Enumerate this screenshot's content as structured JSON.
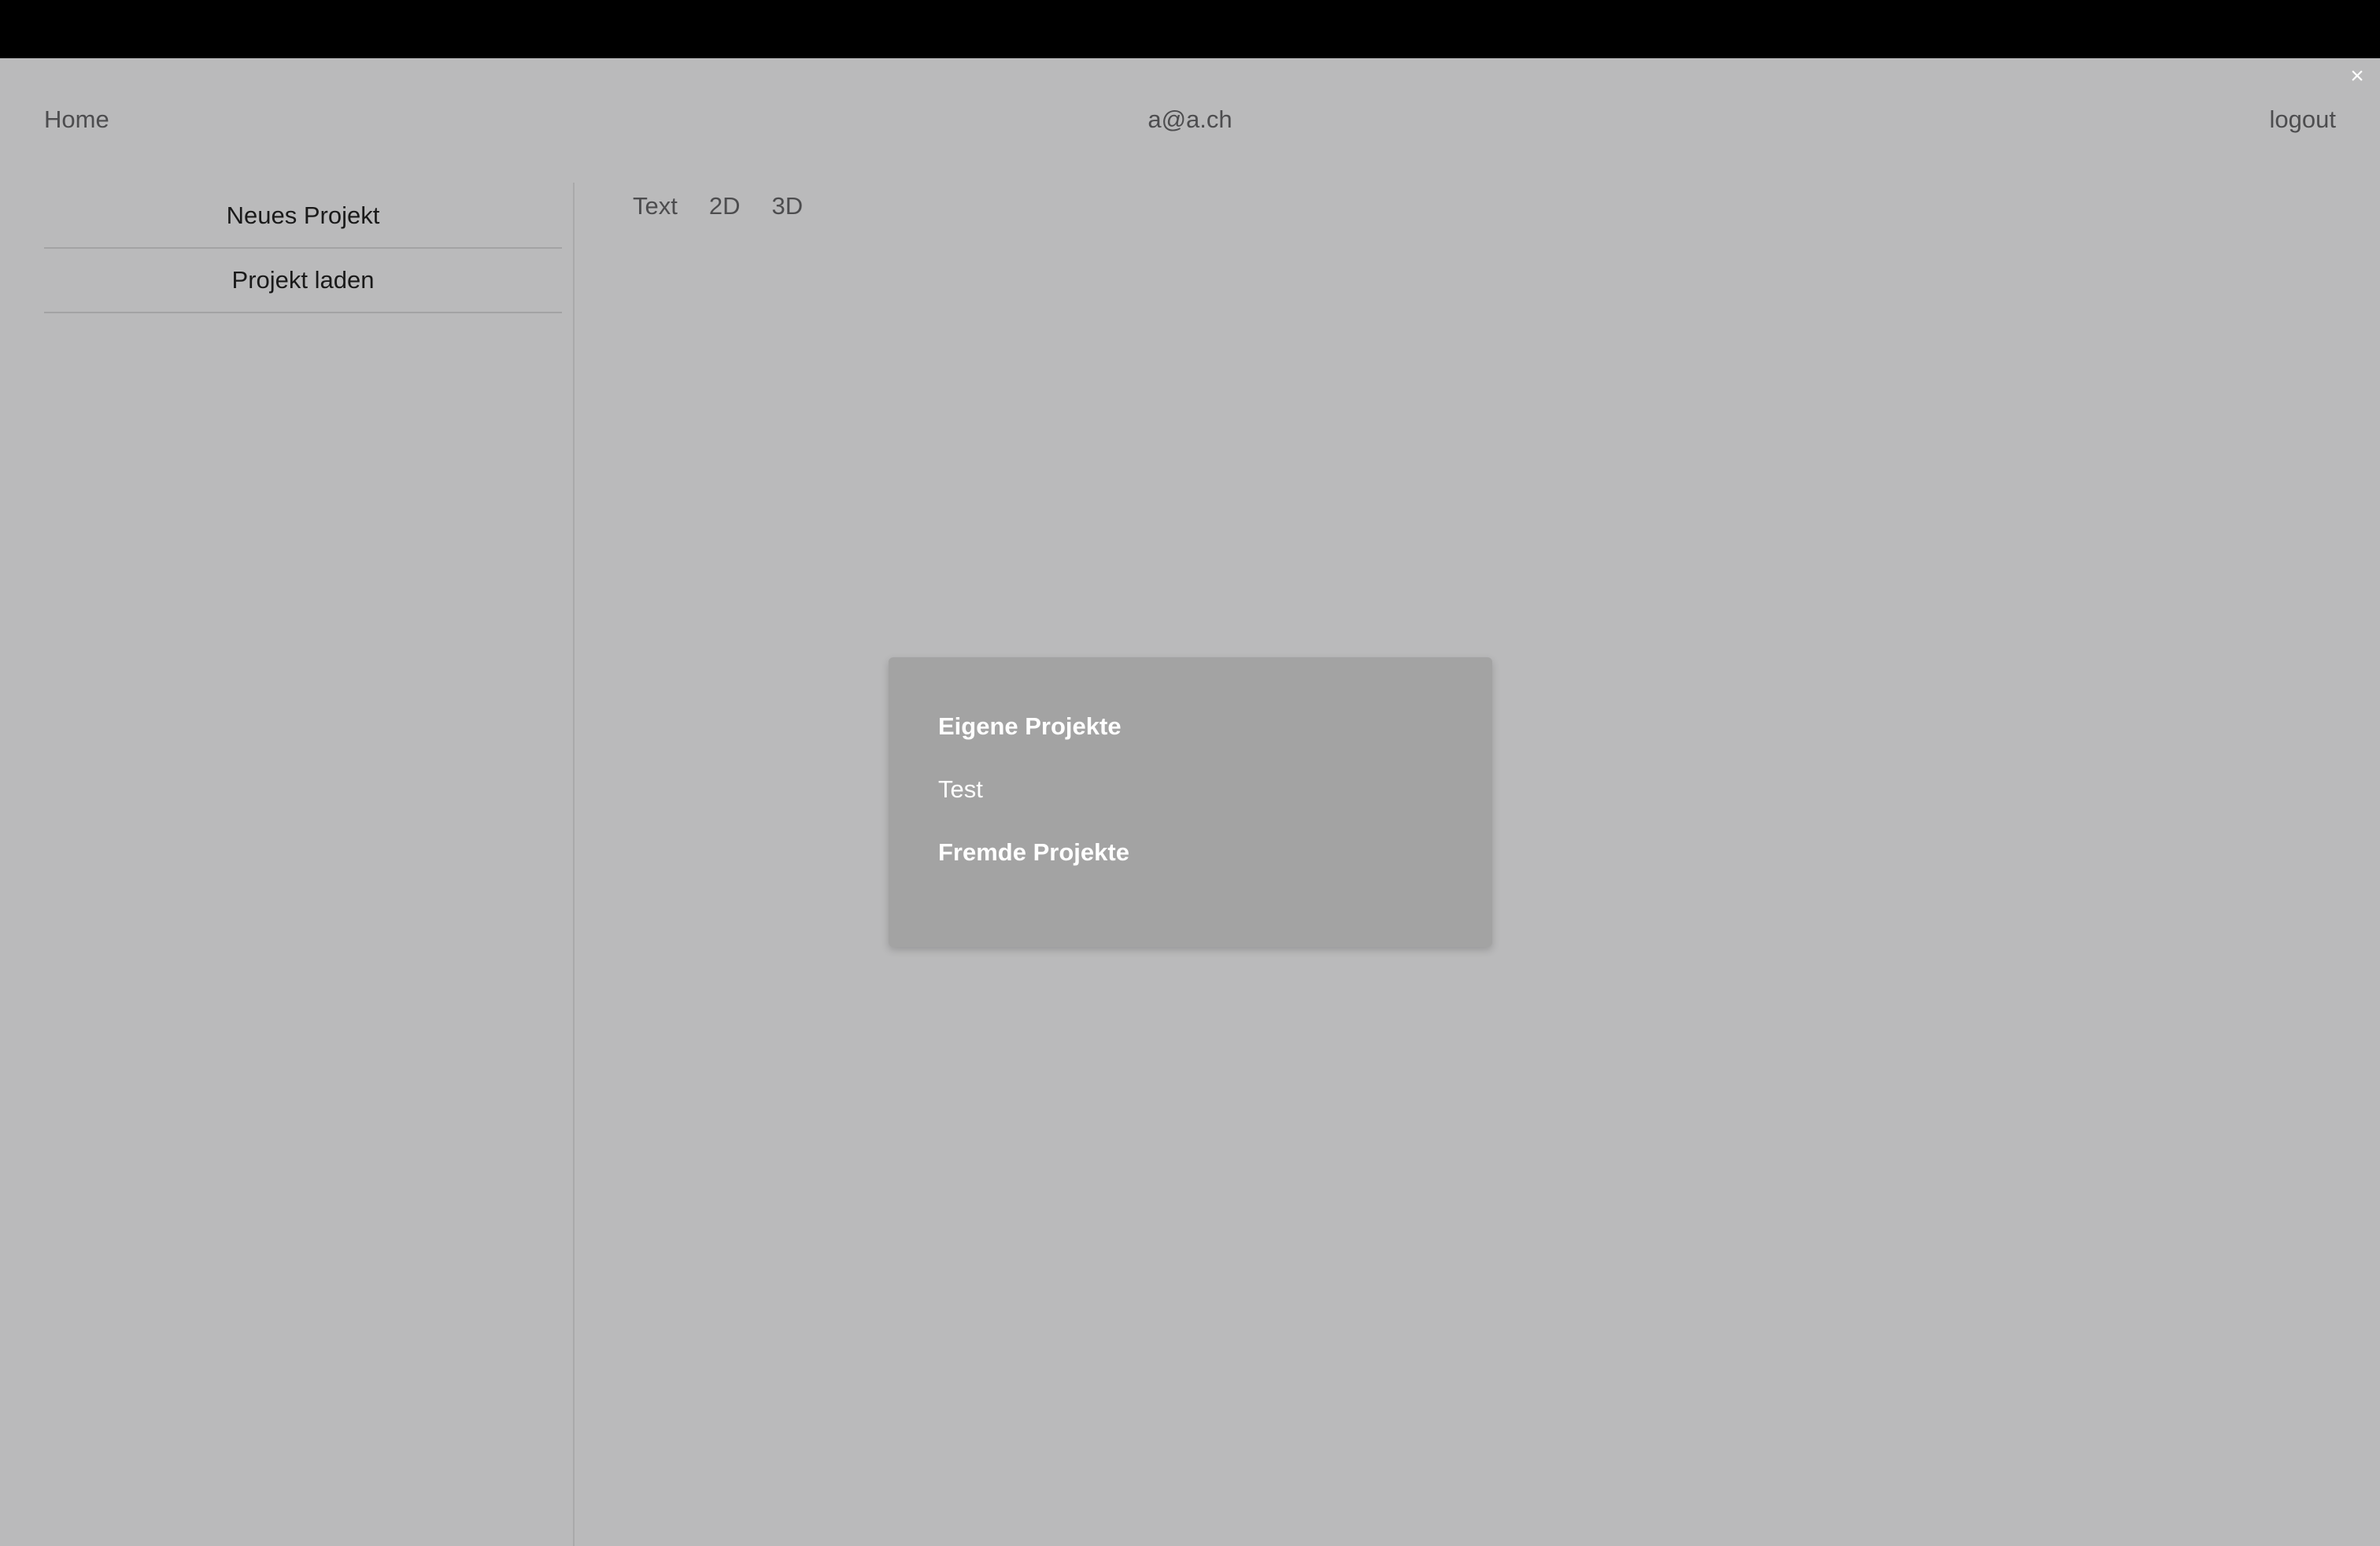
{
  "window": {
    "close_label": "×"
  },
  "header": {
    "home": "Home",
    "user_email": "a@a.ch",
    "logout": "logout"
  },
  "sidebar": {
    "items": [
      {
        "label": "Neues Projekt"
      },
      {
        "label": "Projekt laden"
      }
    ]
  },
  "tabs": [
    {
      "label": "Text"
    },
    {
      "label": "2D"
    },
    {
      "label": "3D"
    }
  ],
  "load_dialog": {
    "own_heading": "Eigene Projekte",
    "own_projects": [
      {
        "label": "Test"
      }
    ],
    "foreign_heading": "Fremde Projekte"
  },
  "colors": {
    "background": "#bababb",
    "topbar": "#000000",
    "dialog_background": "#a3a3a3",
    "dialog_text": "#ffffff"
  }
}
